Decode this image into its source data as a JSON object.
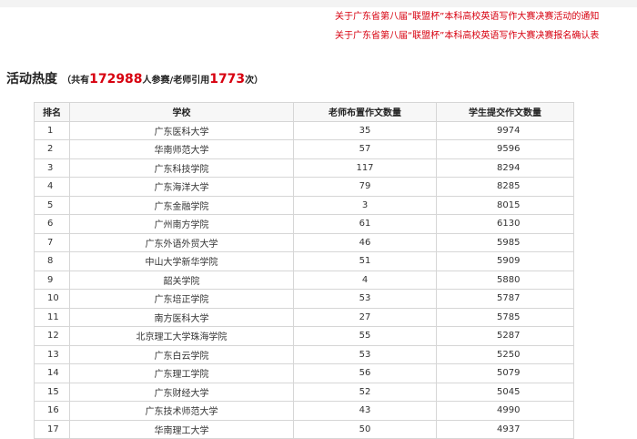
{
  "notices": [
    "关于广东省第八届“联盟杯”本科高校英语写作大赛决赛活动的通知",
    "关于广东省第八届“联盟杯”本科高校英语写作大赛决赛报名确认表"
  ],
  "heading": {
    "title": "活动热度",
    "prefix": "（共有",
    "participants": "172988",
    "middle": "人参赛/老师引用",
    "citations": "1773",
    "suffix": "次）"
  },
  "table": {
    "headers": [
      "排名",
      "学校",
      "老师布置作文数量",
      "学生提交作文数量"
    ],
    "rows": [
      {
        "rank": "1",
        "school": "广东医科大学",
        "teacher": "35",
        "student": "9974"
      },
      {
        "rank": "2",
        "school": "华南师范大学",
        "teacher": "57",
        "student": "9596"
      },
      {
        "rank": "3",
        "school": "广东科技学院",
        "teacher": "117",
        "student": "8294"
      },
      {
        "rank": "4",
        "school": "广东海洋大学",
        "teacher": "79",
        "student": "8285"
      },
      {
        "rank": "5",
        "school": "广东金融学院",
        "teacher": "3",
        "student": "8015"
      },
      {
        "rank": "6",
        "school": "广州南方学院",
        "teacher": "61",
        "student": "6130"
      },
      {
        "rank": "7",
        "school": "广东外语外贸大学",
        "teacher": "46",
        "student": "5985"
      },
      {
        "rank": "8",
        "school": "中山大学新华学院",
        "teacher": "51",
        "student": "5909"
      },
      {
        "rank": "9",
        "school": "韶关学院",
        "teacher": "4",
        "student": "5880"
      },
      {
        "rank": "10",
        "school": "广东培正学院",
        "teacher": "53",
        "student": "5787"
      },
      {
        "rank": "11",
        "school": "南方医科大学",
        "teacher": "27",
        "student": "5785"
      },
      {
        "rank": "12",
        "school": "北京理工大学珠海学院",
        "teacher": "55",
        "student": "5287"
      },
      {
        "rank": "13",
        "school": "广东白云学院",
        "teacher": "53",
        "student": "5250"
      },
      {
        "rank": "14",
        "school": "广东理工学院",
        "teacher": "56",
        "student": "5079"
      },
      {
        "rank": "15",
        "school": "广东财经大学",
        "teacher": "52",
        "student": "5045"
      },
      {
        "rank": "16",
        "school": "广东技术师范大学",
        "teacher": "43",
        "student": "4990"
      },
      {
        "rank": "17",
        "school": "华南理工大学",
        "teacher": "50",
        "student": "4937"
      }
    ]
  }
}
